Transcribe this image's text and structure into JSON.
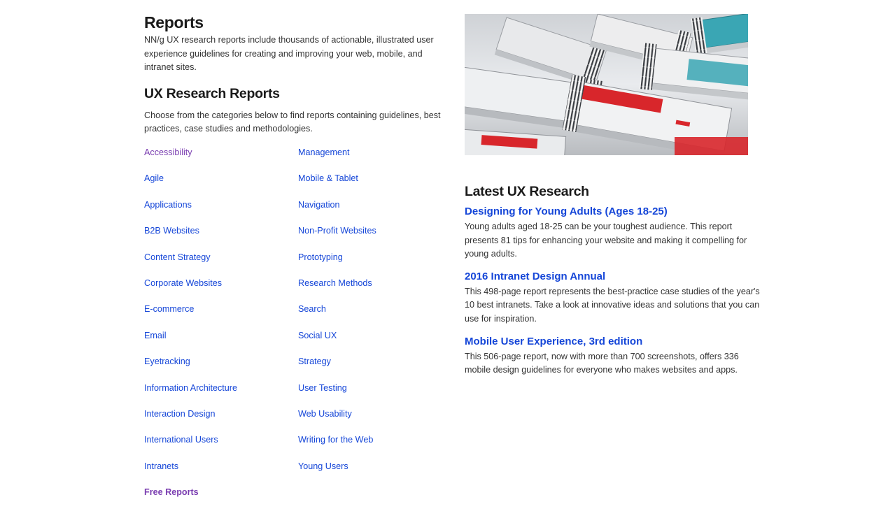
{
  "reports": {
    "title": "Reports",
    "intro": "NN/g UX research reports include thousands of actionable, illustrated user experience guidelines for creating and improving your web, mobile, and intranet sites."
  },
  "ux_research": {
    "heading": "UX Research Reports",
    "choose_text": "Choose from the categories below to find reports containing guidelines, best practices, case studies and methodologies."
  },
  "categories": {
    "col1": [
      "Accessibility",
      "Agile",
      "Applications",
      "B2B Websites",
      "Content Strategy",
      "Corporate Websites",
      "E-commerce",
      "Email",
      "Eyetracking",
      "Information Architecture",
      "Interaction Design",
      "International Users",
      "Intranets",
      "Free Reports"
    ],
    "col2": [
      "Management",
      "Mobile & Tablet",
      "Navigation",
      "Non-Profit Websites",
      "Prototyping",
      "Research Methods",
      "Search",
      "Social UX",
      "Strategy",
      "User Testing",
      "Web Usability",
      "Writing for the Web",
      "Young Users"
    ]
  },
  "colors": {
    "link": "#1546d8",
    "visited": "#7a3db0"
  },
  "latest": {
    "heading": "Latest UX Research",
    "items": [
      {
        "title": "Designing for Young Adults (Ages 18-25)",
        "desc": "Young adults aged 18-25 can be your toughest audience. This report presents 81 tips for enhancing your website and making it compelling for young adults."
      },
      {
        "title": "2016 Intranet Design Annual",
        "desc": "This 498-page report represents the best-practice case studies of the year's 10 best intranets. Take a look at innovative ideas and solutions that you can use for inspiration."
      },
      {
        "title": "Mobile User Experience, 3rd edition",
        "desc": "This 506-page report, now with more than 700 screenshots, offers 336 mobile design guidelines for everyone who makes websites and apps."
      }
    ]
  }
}
